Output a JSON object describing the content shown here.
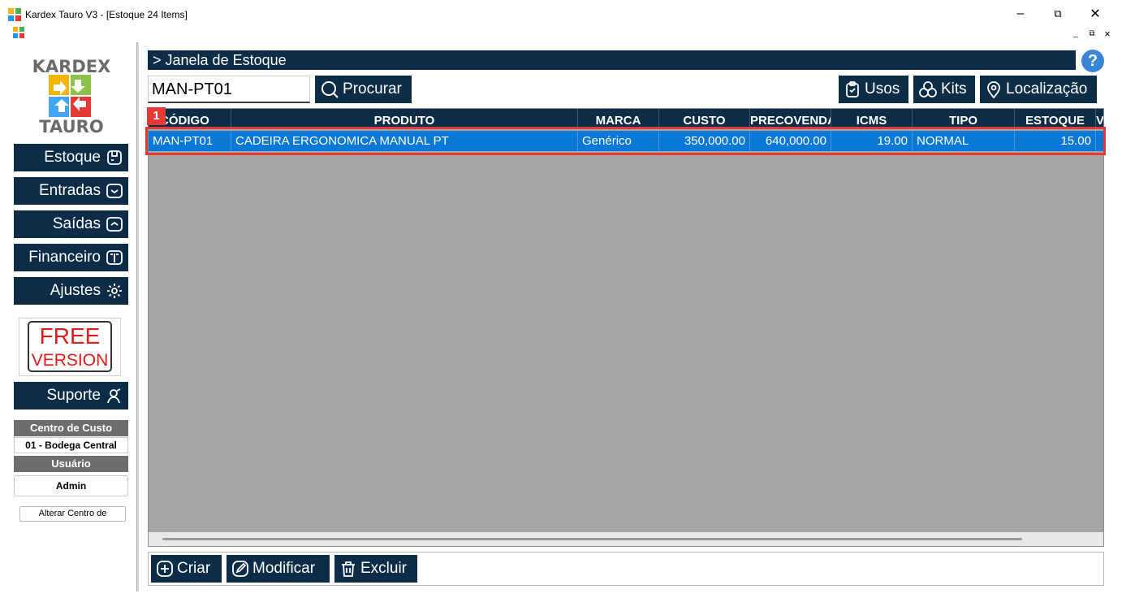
{
  "window": {
    "title": "Kardex Tauro V3 - [Estoque 24 Items]",
    "minimize_glyph": "–",
    "maximize_glyph": "⧉",
    "close_glyph": "✕",
    "mdi_min": "_",
    "mdi_restore": "⧉",
    "mdi_close": "×"
  },
  "sidebar": {
    "logo_top": "KARDEX",
    "logo_bottom": "TAURO",
    "nav": [
      {
        "label": "Estoque",
        "icon": "box-icon"
      },
      {
        "label": "Entradas",
        "icon": "inbox-down-icon"
      },
      {
        "label": "Saídas",
        "icon": "inbox-up-icon"
      },
      {
        "label": "Financeiro",
        "icon": "book-icon"
      },
      {
        "label": "Ajustes",
        "icon": "gear-icon"
      }
    ],
    "free_line1": "FREE",
    "free_line2": "VERSION",
    "suporte": "Suporte",
    "centro_label": "Centro de Custo",
    "centro_value": "01 - Bodega Central",
    "usuario_label": "Usuário",
    "usuario_value": "Admin",
    "alterar": "Alterar Centro de"
  },
  "main": {
    "header": "> Janela de Estoque",
    "help": "?",
    "search_value": "MAN-PT01",
    "search_button": "Procurar",
    "usos": "Usos",
    "kits": "Kits",
    "localizacao": "Localização",
    "marker": "1",
    "columns": [
      "CÓDIGO",
      "PRODUTO",
      "MARCA",
      "CUSTO",
      "PRECOVENDA",
      "ICMS",
      "TIPO",
      "ESTOQUE",
      "V"
    ],
    "rows": [
      [
        "MAN-PT01",
        "CADEIRA ERGONOMICA MANUAL PT",
        "Genérico",
        "350,000.00",
        "640,000.00",
        "19.00",
        "NORMAL",
        "15.00",
        ""
      ]
    ],
    "criar": "Criar",
    "modificar": "Modificar",
    "excluir": "Excluir"
  },
  "colors": {
    "navy": "#0d2c48",
    "selected_row": "#0a78d6",
    "highlight": "#e53935",
    "grid_bg": "#a6a6a6"
  }
}
